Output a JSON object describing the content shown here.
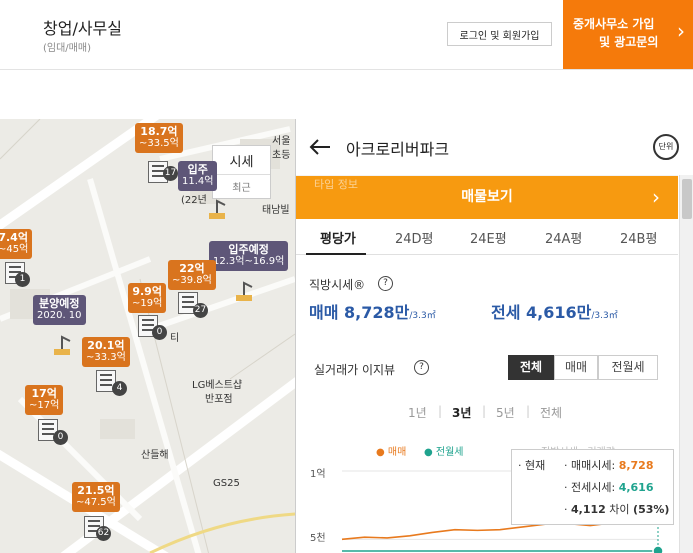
{
  "header": {
    "title": "창업/사무실",
    "subtitle": "(임대/매매)",
    "login_label": "로그인 및 회원가입",
    "ad_line1": "중개사무소 가입",
    "ad_line2": "및 광고문의"
  },
  "map": {
    "price_tab": {
      "label": "시세",
      "recent": "최근"
    },
    "markers": [
      {
        "big": "18.7억",
        "small": "~33.5억",
        "color": "orange"
      },
      {
        "big": "7.4억",
        "small": "~45억",
        "color": "orange"
      },
      {
        "big": "입주",
        "small": "11.4억",
        "color": "purple"
      },
      {
        "big": "입주예정",
        "small": "12.3억~16.9억",
        "color": "purple"
      },
      {
        "big": "22억",
        "small": "~39.8억",
        "color": "orange"
      },
      {
        "big": "9.9억",
        "small": "~19억",
        "color": "orange"
      },
      {
        "big": "분양예정",
        "small": "2020. 10",
        "color": "purple"
      },
      {
        "big": "20.1억",
        "small": "~33.3억",
        "color": "orange"
      },
      {
        "big": "17억",
        "small": "~17억",
        "color": "orange"
      },
      {
        "big": "21.5억",
        "small": "~47.5억",
        "color": "orange"
      }
    ],
    "counts": [
      "17",
      "1",
      "27",
      "0",
      "4",
      "0",
      "62"
    ],
    "labels": {
      "lg": "LG베스트샵",
      "banpo": "반포점",
      "sanduel": "산들해",
      "gs": "GS25",
      "tn": "태남빌",
      "seoul": "서울",
      "chodeung": "초등",
      "ti": "티",
      "twenty2": "(22년"
    }
  },
  "panel": {
    "title": "아크로리버파크",
    "unit_label": "단위",
    "partial_text": "타입 정보",
    "listing_button": "매물보기",
    "tabs": [
      "평당가",
      "24D평",
      "24E평",
      "24A평",
      "24B평"
    ],
    "price_section_label": "직방시세®",
    "help_mark": "?",
    "sale_label": "매매",
    "sale_value": "8,728만",
    "rent_label": "전세",
    "rent_value": "4,616만",
    "per_unit": "/3.3㎡",
    "history_label": "실거래가 이지뷰",
    "filters": [
      "전체",
      "매매",
      "전월세"
    ],
    "periods": [
      "1년",
      "3년",
      "5년",
      "전체"
    ],
    "legend": [
      "매매",
      "전월세"
    ],
    "legend_ghost": "직방시세 · 거래량",
    "y_ticks": [
      "1억",
      "5천"
    ],
    "tooltip": {
      "now": "· 현재",
      "sale_label": "· 매매시세:",
      "sale_value": "8,728",
      "rent_label": "· 전세시세:",
      "rent_value": "4,616",
      "diff_value": "4,112",
      "diff_label": "차이",
      "diff_pct": "(53%)"
    }
  },
  "colors": {
    "accent_orange": "#f57a0b",
    "listing_orange": "#f79a10",
    "price_blue": "#2b5aa6",
    "sale_line": "#e87a1e",
    "rent_line": "#1fa38e"
  },
  "chart_data": {
    "type": "line",
    "series": [
      {
        "name": "매매",
        "values": [
          7200,
          7350,
          7300,
          7450,
          7700,
          7900,
          7850,
          7900,
          8100,
          8300,
          8350,
          8200,
          8400,
          8450,
          8728
        ]
      },
      {
        "name": "전월세",
        "values": [
          4150,
          4200,
          4180,
          4250,
          4200,
          4300,
          4280,
          4350,
          4300,
          4380,
          4400,
          4350,
          4450,
          4500,
          4616
        ]
      }
    ],
    "y_ticks": [
      "1억",
      "5천"
    ],
    "ylim": [
      4000,
      10000
    ]
  }
}
